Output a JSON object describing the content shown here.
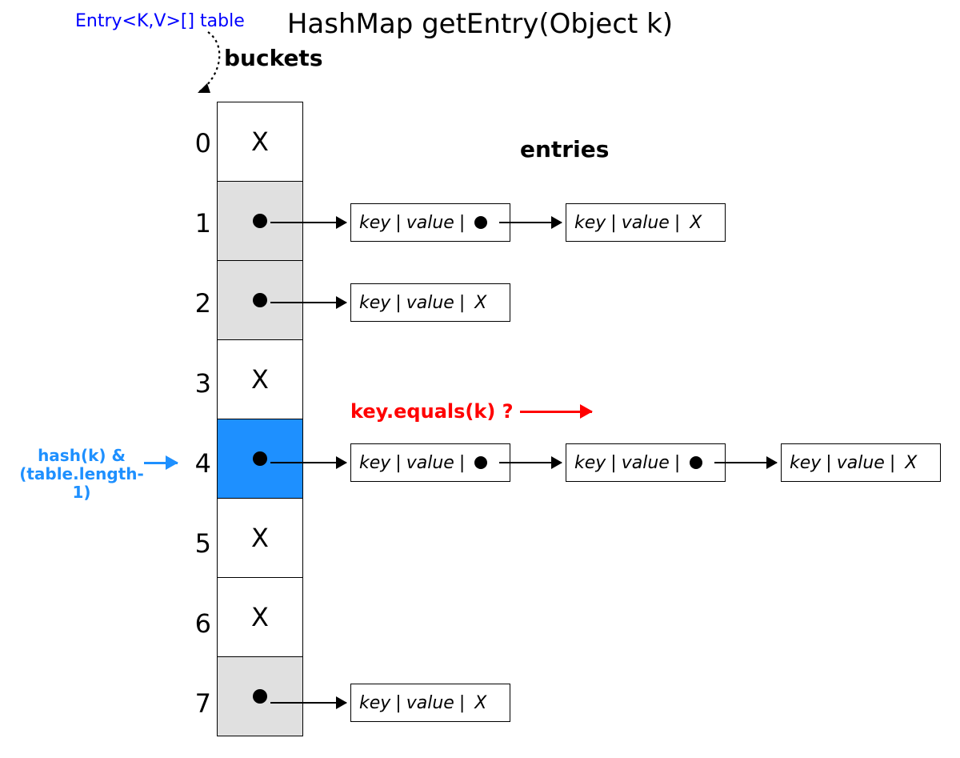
{
  "title": "HashMap getEntry(Object k)",
  "entry_label": "Entry<K,V>[] table",
  "buckets_label": "buckets",
  "entries_label": "entries",
  "hash_label_line1": "hash(k) &",
  "hash_label_line2": "(table.length-1)",
  "equals_label": "key.equals(k) ?",
  "buckets": [
    {
      "index": "0",
      "type": "empty",
      "text": "X"
    },
    {
      "index": "1",
      "type": "pointer"
    },
    {
      "index": "2",
      "type": "pointer"
    },
    {
      "index": "3",
      "type": "empty",
      "text": "X"
    },
    {
      "index": "4",
      "type": "pointer",
      "highlight": true
    },
    {
      "index": "5",
      "type": "empty",
      "text": "X"
    },
    {
      "index": "6",
      "type": "empty",
      "text": "X"
    },
    {
      "index": "7",
      "type": "pointer"
    }
  ],
  "entry_box": {
    "key": "key",
    "value": "value",
    "null_marker": "X"
  },
  "chains": {
    "row1": [
      {
        "has_next": true
      },
      {
        "has_next": false
      }
    ],
    "row2": [
      {
        "has_next": false
      }
    ],
    "row4": [
      {
        "has_next": true
      },
      {
        "has_next": true
      },
      {
        "has_next": false
      }
    ],
    "row7": [
      {
        "has_next": false
      }
    ]
  }
}
